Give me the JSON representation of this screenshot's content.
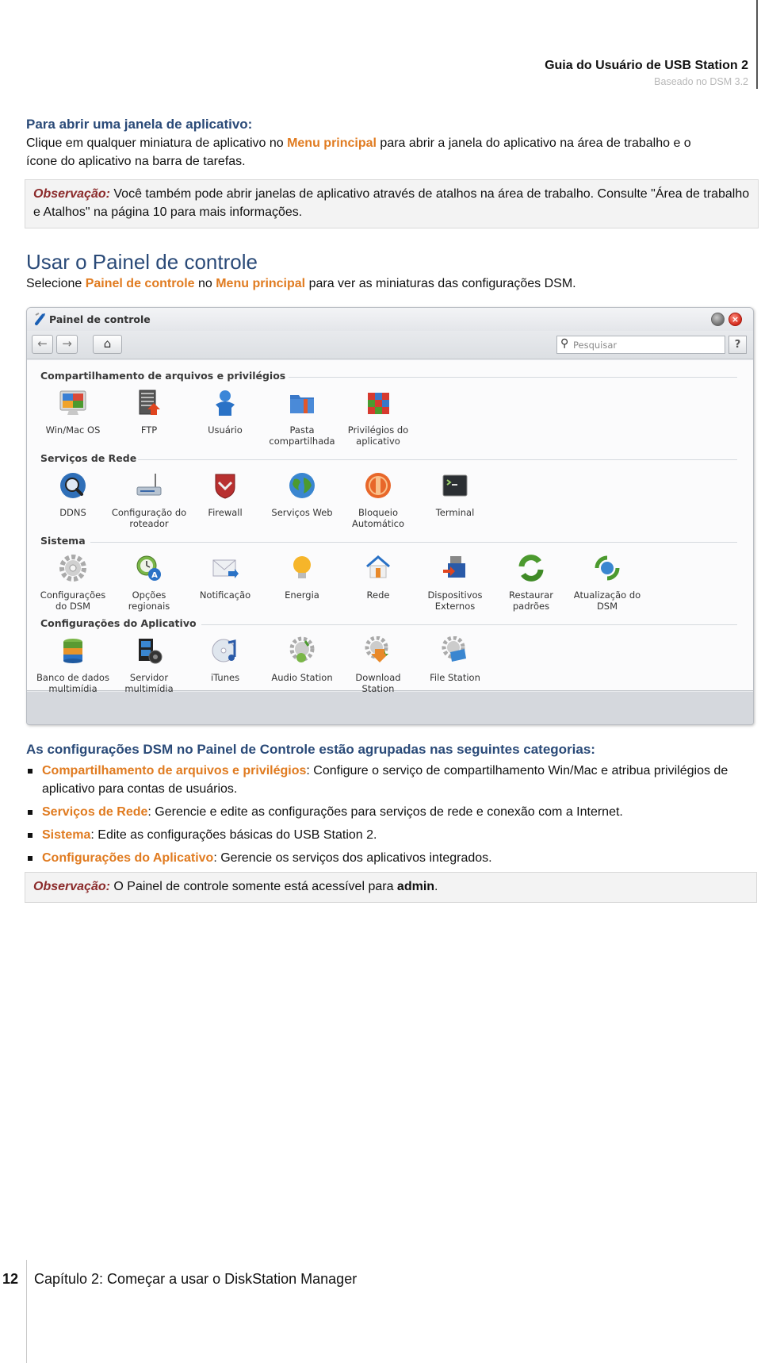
{
  "header": {
    "title": "Guia do Usuário de USB Station 2",
    "subtitle": "Baseado no DSM 3.2"
  },
  "section_open_app": {
    "heading": "Para abrir uma janela de aplicativo:",
    "text_1": "Clique em qualquer miniatura de aplicativo no ",
    "highlight_1": "Menu principal",
    "text_2": " para abrir a janela do aplicativo na área de trabalho e o ícone do aplicativo na barra de tarefas.",
    "note_label": "Observação:",
    "note_text": " Você também pode abrir janelas de aplicativo através de atalhos na área de trabalho. Consulte \"Área de trabalho e Atalhos\" na página 10 para mais informações."
  },
  "section_control_panel": {
    "heading": "Usar o Painel de controle",
    "text_1": "Selecione ",
    "highlight_1": "Painel de controle",
    "text_2": " no ",
    "highlight_2": "Menu principal",
    "text_3": " para ver as miniaturas das configurações DSM."
  },
  "control_panel_window": {
    "title": "Painel de controle",
    "close_glyph": "×",
    "back_glyph": "←",
    "forward_glyph": "→",
    "home_glyph": "⌂",
    "search_glyph": "⚲",
    "search_placeholder": "Pesquisar",
    "help_label": "?",
    "categories": [
      {
        "title": "Compartilhamento de arquivos e privilégios",
        "items": [
          {
            "label_1": "Win/Mac OS",
            "label_2": "",
            "icon": "monitor-icon"
          },
          {
            "label_1": "FTP",
            "label_2": "",
            "icon": "ftp-server-icon"
          },
          {
            "label_1": "Usuário",
            "label_2": "",
            "icon": "user-icon"
          },
          {
            "label_1": "Pasta",
            "label_2": "compartilhada",
            "icon": "shared-folder-icon"
          },
          {
            "label_1": "Privilégios do",
            "label_2": "aplicativo",
            "icon": "app-privileges-cube-icon"
          }
        ]
      },
      {
        "title": "Serviços de Rede",
        "items": [
          {
            "label_1": "DDNS",
            "label_2": "",
            "icon": "ddns-magnifier-icon"
          },
          {
            "label_1": "Configuração do",
            "label_2": "roteador",
            "icon": "router-icon"
          },
          {
            "label_1": "Firewall",
            "label_2": "",
            "icon": "firewall-shield-icon"
          },
          {
            "label_1": "Serviços Web",
            "label_2": "",
            "icon": "globe-icon"
          },
          {
            "label_1": "Bloqueio",
            "label_2": "Automático",
            "icon": "auto-block-icon"
          },
          {
            "label_1": "Terminal",
            "label_2": "",
            "icon": "terminal-icon"
          }
        ]
      },
      {
        "title": "Sistema",
        "items": [
          {
            "label_1": "Configurações",
            "label_2": "do DSM",
            "icon": "gear-icon"
          },
          {
            "label_1": "Opções",
            "label_2": "regionais",
            "icon": "regional-clock-icon"
          },
          {
            "label_1": "Notificação",
            "label_2": "",
            "icon": "envelope-icon"
          },
          {
            "label_1": "Energia",
            "label_2": "",
            "icon": "lightbulb-icon"
          },
          {
            "label_1": "Rede",
            "label_2": "",
            "icon": "house-network-icon"
          },
          {
            "label_1": "Dispositivos",
            "label_2": "Externos",
            "icon": "external-device-icon"
          },
          {
            "label_1": "Restaurar",
            "label_2": "padrões",
            "icon": "restore-arrows-icon"
          },
          {
            "label_1": "Atualização do",
            "label_2": "DSM",
            "icon": "dsm-update-icon"
          }
        ]
      },
      {
        "title": "Configurações do Aplicativo",
        "items": [
          {
            "label_1": "Banco de dados",
            "label_2": "multimídia",
            "icon": "database-icon"
          },
          {
            "label_1": "Servidor",
            "label_2": "multimídia",
            "icon": "media-server-icon"
          },
          {
            "label_1": "iTunes",
            "label_2": "",
            "icon": "itunes-icon"
          },
          {
            "label_1": "Audio Station",
            "label_2": "",
            "icon": "audio-station-icon"
          },
          {
            "label_1": "Download",
            "label_2": "Station",
            "icon": "download-station-icon"
          },
          {
            "label_1": "File Station",
            "label_2": "",
            "icon": "file-station-icon"
          }
        ]
      }
    ]
  },
  "section_categories": {
    "heading": "As configurações DSM no Painel de Controle estão agrupadas nas seguintes categorias:",
    "bullets": [
      {
        "term": "Compartilhamento de arquivos e privilégios",
        "text": ": Configure o serviço de compartilhamento Win/Mac e atribua privilégios de aplicativo para contas de usuários."
      },
      {
        "term": "Serviços de Rede",
        "text": ": Gerencie e edite as configurações para serviços de rede e conexão com a Internet."
      },
      {
        "term": "Sistema",
        "text": ": Edite as configurações básicas do USB Station 2."
      },
      {
        "term": "Configurações do Aplicativo",
        "text": ": Gerencie os serviços dos aplicativos integrados."
      }
    ],
    "note_label": "Observação:",
    "note_text_1": " O Painel de controle somente está acessível para ",
    "note_bold": "admin",
    "note_text_2": "."
  },
  "footer": {
    "page_number": "12",
    "chapter": "Capítulo 2: Começar a usar o DiskStation Manager"
  },
  "colors": {
    "heading_blue": "#2a4a78",
    "highlight_orange": "#e07b20",
    "note_label_red": "#8b2a2a",
    "note_background": "#f3f3f3"
  }
}
